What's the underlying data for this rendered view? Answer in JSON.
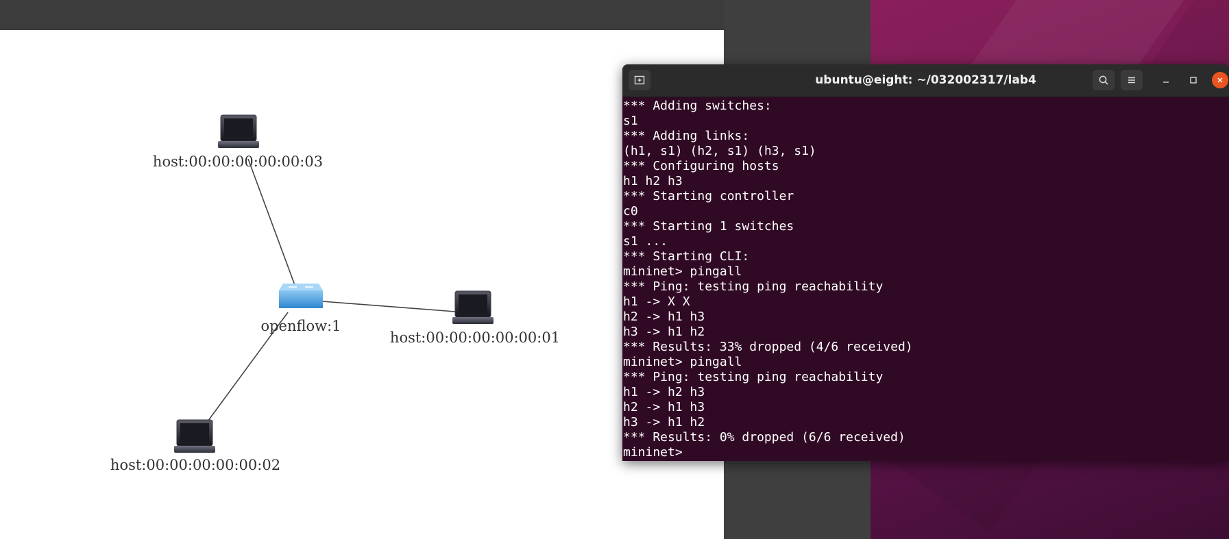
{
  "topology": {
    "nodes": [
      {
        "id": "host3",
        "label": "host:00:00:00:00:00:03",
        "kind": "host"
      },
      {
        "id": "switch1",
        "label": "openflow:1",
        "kind": "switch"
      },
      {
        "id": "host1",
        "label": "host:00:00:00:00:00:01",
        "kind": "host"
      },
      {
        "id": "host2",
        "label": "host:00:00:00:00:00:02",
        "kind": "host"
      }
    ],
    "links": [
      [
        "switch1",
        "host3"
      ],
      [
        "switch1",
        "host1"
      ],
      [
        "switch1",
        "host2"
      ]
    ]
  },
  "terminal": {
    "title": "ubuntu@eight: ~/032002317/lab4",
    "lines": [
      "*** Adding switches:",
      "s1",
      "*** Adding links:",
      "(h1, s1) (h2, s1) (h3, s1)",
      "*** Configuring hosts",
      "h1 h2 h3",
      "*** Starting controller",
      "c0",
      "*** Starting 1 switches",
      "s1 ...",
      "*** Starting CLI:",
      "mininet> pingall",
      "*** Ping: testing ping reachability",
      "h1 -> X X",
      "h2 -> h1 h3",
      "h3 -> h1 h2",
      "*** Results: 33% dropped (4/6 received)",
      "mininet> pingall",
      "*** Ping: testing ping reachability",
      "h1 -> h2 h3",
      "h2 -> h1 h3",
      "h3 -> h1 h2",
      "*** Results: 0% dropped (6/6 received)",
      "mininet> "
    ],
    "icons": {
      "new_tab": "new-tab-icon",
      "search": "search-icon",
      "menu": "hamburger-menu-icon",
      "minimize": "minimize-icon",
      "maximize": "maximize-icon",
      "close": "close-icon"
    },
    "colors": {
      "background": "#300a24",
      "close_button": "#e95420"
    }
  }
}
